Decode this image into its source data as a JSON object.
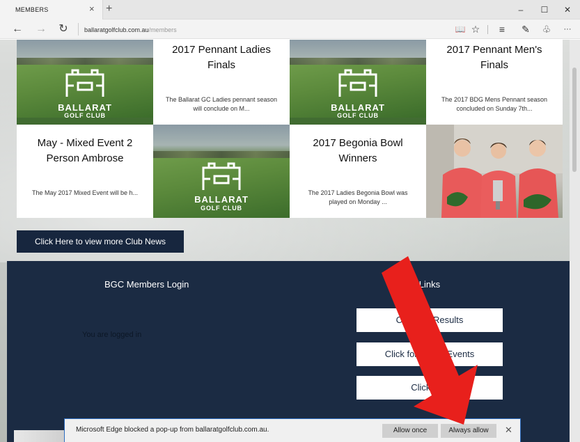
{
  "browser": {
    "tab_title": "MEMBERS",
    "tab_close": "×",
    "new_tab": "+",
    "window_minimize": "–",
    "window_maximize": "☐",
    "window_close": "✕",
    "back": "←",
    "forward": "→",
    "refresh": "↻",
    "url_host": "ballaratgolfclub.com.au",
    "url_path": "/members",
    "reading_view": "📖",
    "favorite": "☆",
    "hub": "≡",
    "web_note": "✎",
    "share": "♧",
    "more": "···"
  },
  "logo": {
    "line1": "BALLARAT",
    "line2": "GOLF CLUB"
  },
  "news": [
    {
      "title": "2017 Pennant Ladies Finals",
      "excerpt": "The Ballarat GC Ladies pennant season will conclude on M..."
    },
    {
      "title": "2017 Pennant Men's Finals",
      "excerpt": "The 2017 BDG Mens Pennant season concluded on Sunday 7th..."
    },
    {
      "title": "May - Mixed Event 2 Person Ambrose",
      "excerpt": "The May 2017 Mixed Event will be h..."
    },
    {
      "title": "2017 Begonia Bowl Winners",
      "excerpt": "The 2017 Ladies Begonia Bowl was played on Monday ..."
    }
  ],
  "news_button": "Click Here to view more Club News",
  "members": {
    "login_title": "BGC Members Login",
    "logged_in": "You are logged in",
    "links_title": "mbers Links",
    "links": [
      "Click     mp Results",
      "Click for Up        ng Events",
      "Click fo             e"
    ]
  },
  "notification": {
    "message": "Microsoft Edge blocked a pop-up from ballaratgolfclub.com.au.",
    "allow_once": "Allow once",
    "always_allow": "Always allow",
    "close": "✕"
  },
  "colors": {
    "navy": "#1b2b43",
    "arrow_red": "#e8201c",
    "edge_blue": "#2d6cc0"
  }
}
